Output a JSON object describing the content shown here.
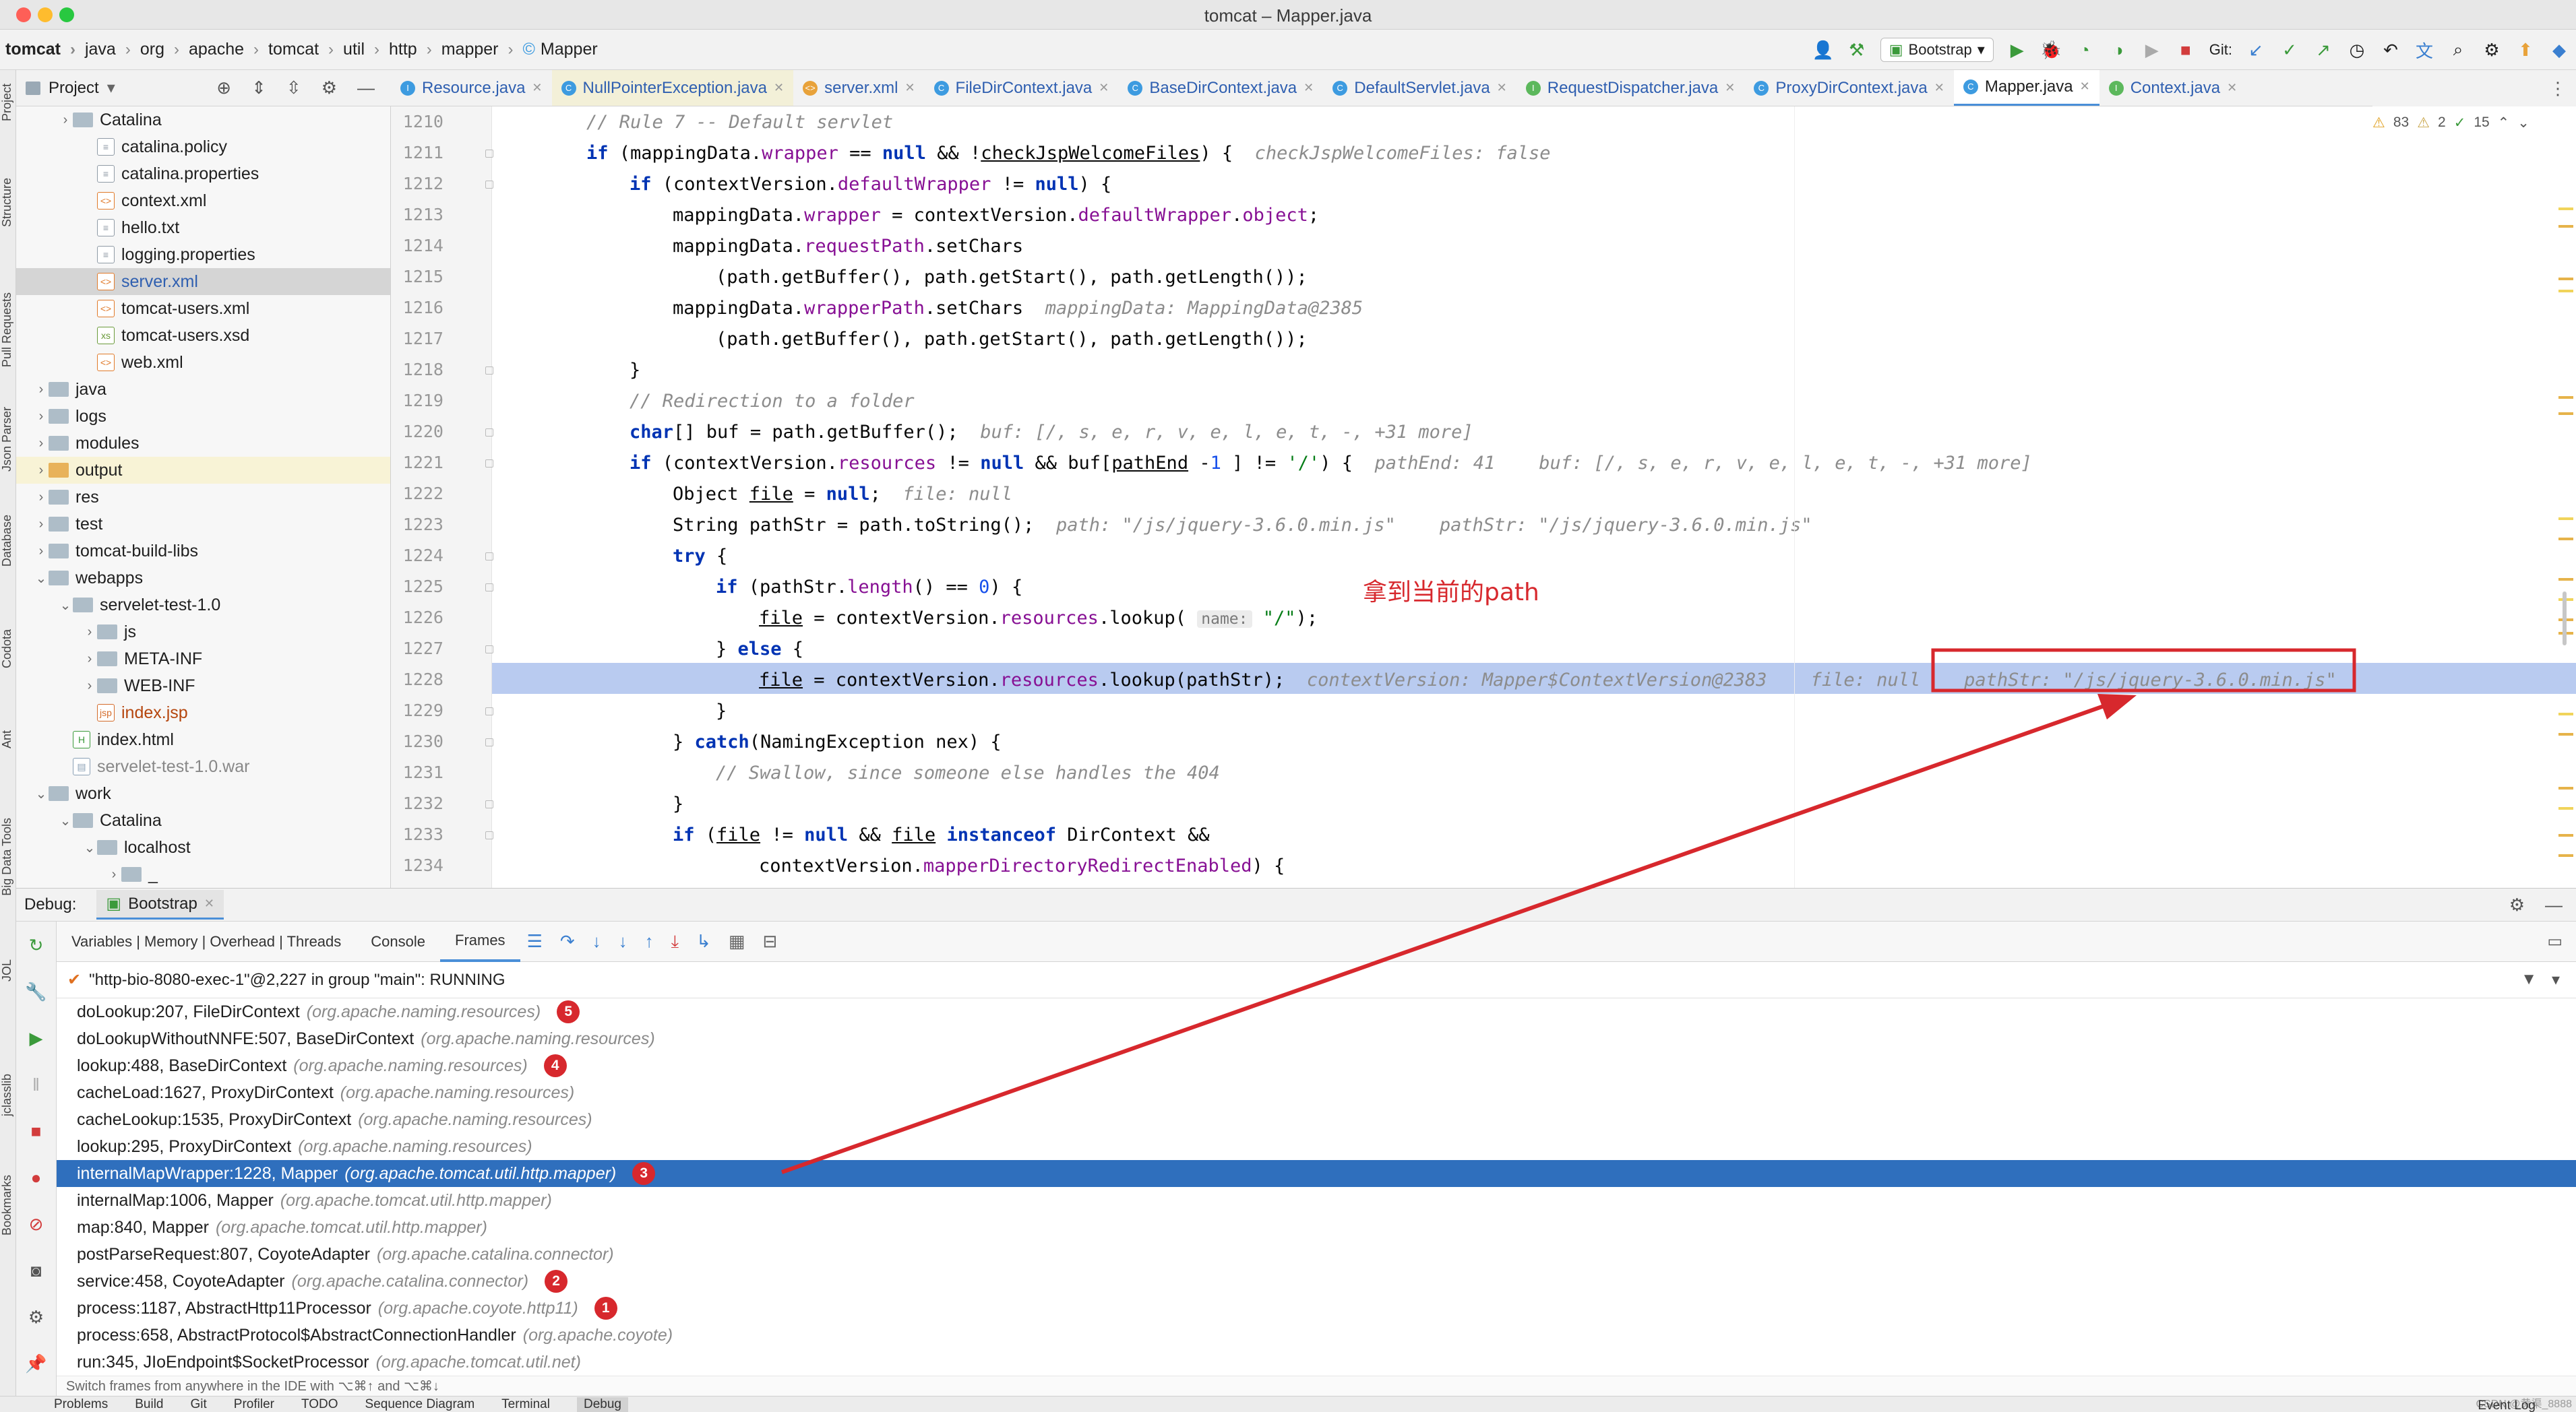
{
  "window": {
    "title": "tomcat – Mapper.java"
  },
  "breadcrumbs": [
    "tomcat",
    "java",
    "org",
    "apache",
    "tomcat",
    "util",
    "http",
    "mapper",
    "Mapper"
  ],
  "toolbar": {
    "run_config": "Bootstrap",
    "git_label": "Git:"
  },
  "project_panel": {
    "title": "Project",
    "tree": [
      {
        "label": "Catalina",
        "kind": "folder",
        "depth": 2,
        "expander": "closed"
      },
      {
        "label": "catalina.policy",
        "kind": "file",
        "depth": 3
      },
      {
        "label": "catalina.properties",
        "kind": "file",
        "depth": 3
      },
      {
        "label": "context.xml",
        "kind": "xml",
        "depth": 3
      },
      {
        "label": "hello.txt",
        "kind": "file",
        "depth": 3
      },
      {
        "label": "logging.properties",
        "kind": "file",
        "depth": 3
      },
      {
        "label": "server.xml",
        "kind": "xml",
        "depth": 3,
        "selected": true
      },
      {
        "label": "tomcat-users.xml",
        "kind": "xml",
        "depth": 3
      },
      {
        "label": "tomcat-users.xsd",
        "kind": "xsd",
        "depth": 3
      },
      {
        "label": "web.xml",
        "kind": "xml",
        "depth": 3
      },
      {
        "label": "java",
        "kind": "folder",
        "depth": 1,
        "expander": "closed"
      },
      {
        "label": "logs",
        "kind": "folder",
        "depth": 1,
        "expander": "closed"
      },
      {
        "label": "modules",
        "kind": "folder",
        "depth": 1,
        "expander": "closed"
      },
      {
        "label": "output",
        "kind": "folder-orange",
        "depth": 1,
        "expander": "closed",
        "highlight": true
      },
      {
        "label": "res",
        "kind": "folder",
        "depth": 1,
        "expander": "closed"
      },
      {
        "label": "test",
        "kind": "folder",
        "depth": 1,
        "expander": "closed"
      },
      {
        "label": "tomcat-build-libs",
        "kind": "folder",
        "depth": 1,
        "expander": "closed"
      },
      {
        "label": "webapps",
        "kind": "folder",
        "depth": 1,
        "expander": "open"
      },
      {
        "label": "servelet-test-1.0",
        "kind": "folder",
        "depth": 2,
        "expander": "open"
      },
      {
        "label": "js",
        "kind": "folder",
        "depth": 3,
        "expander": "closed"
      },
      {
        "label": "META-INF",
        "kind": "folder",
        "depth": 3,
        "expander": "closed"
      },
      {
        "label": "WEB-INF",
        "kind": "folder",
        "depth": 3,
        "expander": "closed"
      },
      {
        "label": "index.jsp",
        "kind": "jsp",
        "depth": 3
      },
      {
        "label": "index.html",
        "kind": "html",
        "depth": 2
      },
      {
        "label": "servelet-test-1.0.war",
        "kind": "war",
        "depth": 2
      },
      {
        "label": "work",
        "kind": "folder",
        "depth": 1,
        "expander": "open"
      },
      {
        "label": "Catalina",
        "kind": "folder",
        "depth": 2,
        "expander": "open"
      },
      {
        "label": "localhost",
        "kind": "folder",
        "depth": 3,
        "expander": "open"
      },
      {
        "label": "_",
        "kind": "folder",
        "depth": 4,
        "expander": "closed"
      }
    ]
  },
  "editor_tabs": [
    {
      "label": "Resource.java",
      "icon": "interface",
      "color": "#3d9be0"
    },
    {
      "label": "NullPointerException.java",
      "icon": "class",
      "color": "#3d9be0",
      "modified": true
    },
    {
      "label": "server.xml",
      "icon": "xml",
      "color": "#e8a23a"
    },
    {
      "label": "FileDirContext.java",
      "icon": "class",
      "color": "#3d9be0"
    },
    {
      "label": "BaseDirContext.java",
      "icon": "class",
      "color": "#3d9be0"
    },
    {
      "label": "DefaultServlet.java",
      "icon": "class",
      "color": "#3d9be0"
    },
    {
      "label": "RequestDispatcher.java",
      "icon": "interface",
      "color": "#5cb85c"
    },
    {
      "label": "ProxyDirContext.java",
      "icon": "class",
      "color": "#3d9be0"
    },
    {
      "label": "Mapper.java",
      "icon": "class",
      "color": "#3d9be0",
      "active": true
    },
    {
      "label": "Context.java",
      "icon": "interface",
      "color": "#5cb85c"
    }
  ],
  "inspections": {
    "warnings": "83",
    "weak": "2",
    "ok": "15"
  },
  "code": {
    "current_line": 1228,
    "lines": [
      {
        "n": "1210",
        "html": "<span class='cm'>// Rule 7 -- Default servlet</span>",
        "indent": 2
      },
      {
        "n": "1211",
        "html": "<span class='kw'>if</span> (mappingData.<span class='fld'>wrapper</span> == <span class='kw'>null</span> &amp;&amp; !<u>checkJspWelcomeFiles</u>) {  <span class='hint'>checkJspWelcomeFiles: false</span>",
        "indent": 2
      },
      {
        "n": "1212",
        "html": "<span class='kw'>if</span> (contextVersion.<span class='fld'>defaultWrapper</span> != <span class='kw'>null</span>) {",
        "indent": 3
      },
      {
        "n": "1213",
        "html": "mappingData.<span class='fld'>wrapper</span> = contextVersion.<span class='fld'>defaultWrapper</span>.<span class='fld'>object</span>;",
        "indent": 4
      },
      {
        "n": "1214",
        "html": "mappingData.<span class='fld'>requestPath</span>.setChars",
        "indent": 4
      },
      {
        "n": "1215",
        "html": "(path.getBuffer(), path.getStart(), path.getLength());",
        "indent": 5
      },
      {
        "n": "1216",
        "html": "mappingData.<span class='fld'>wrapperPath</span>.setChars  <span class='hint'>mappingData: MappingData@2385</span>",
        "indent": 4
      },
      {
        "n": "1217",
        "html": "(path.getBuffer(), path.getStart(), path.getLength());",
        "indent": 5
      },
      {
        "n": "1218",
        "html": "}",
        "indent": 3
      },
      {
        "n": "1219",
        "html": "<span class='cm'>// Redirection to a folder</span>",
        "indent": 3
      },
      {
        "n": "1220",
        "html": "<span class='kw'>char</span>[] buf = path.getBuffer();  <span class='hint'>buf: [/, s, e, r, v, e, l, e, t, -, +31 more]</span>",
        "indent": 3
      },
      {
        "n": "1221",
        "html": "<span class='kw'>if</span> (contextVersion.<span class='fld'>resources</span> != <span class='kw'>null</span> &amp;&amp; buf[<u>pathEnd</u> -<span class='num'>1</span> ] != <span class='str'>'/'</span>) {  <span class='hint'>pathEnd: 41    buf: [/, s, e, r, v, e, l, e, t, -, +31 more]</span>",
        "indent": 3
      },
      {
        "n": "1222",
        "html": "Object <u>file</u> = <span class='kw'>null</span>;  <span class='hint'>file: null</span>",
        "indent": 4
      },
      {
        "n": "1223",
        "html": "String pathStr = path.toString();  <span class='hint'>path: \"/js/jquery-3.6.0.min.js\"    pathStr: \"/js/jquery-3.6.0.min.js\"</span>",
        "indent": 4
      },
      {
        "n": "1224",
        "html": "<span class='kw'>try</span> {",
        "indent": 4
      },
      {
        "n": "1225",
        "html": "<span class='kw'>if</span> (pathStr.<span class='fld'>length</span>() == <span class='num'>0</span>) {",
        "indent": 5
      },
      {
        "n": "1226",
        "html": "<u>file</u> = contextVersion.<span class='fld'>resources</span>.lookup( <span class='hint-box'>name:</span> <span class='str'>\"/\"</span>);",
        "indent": 6
      },
      {
        "n": "1227",
        "html": "} <span class='kw'>else</span> {",
        "indent": 5
      },
      {
        "n": "1228",
        "html": "<u>file</u> = contextVersion.<span class='fld'>resources</span>.lookup(pathStr);  <span class='hint'>contextVersion: Mapper$ContextVersion@2383    file: null    pathStr: \"/js/jquery-3.6.0.min.js\"</span>",
        "indent": 6
      },
      {
        "n": "1229",
        "html": "}",
        "indent": 5
      },
      {
        "n": "1230",
        "html": "} <span class='kw'>catch</span>(NamingException nex) {",
        "indent": 4
      },
      {
        "n": "1231",
        "html": "<span class='cm'>// Swallow, since someone else handles the 404</span>",
        "indent": 5
      },
      {
        "n": "1232",
        "html": "}",
        "indent": 4
      },
      {
        "n": "1233",
        "html": "<span class='kw'>if</span> (<u>file</u> != <span class='kw'>null</span> &amp;&amp; <u>file</u> <span class='kw'>instanceof</span> DirContext &amp;&amp;",
        "indent": 4
      },
      {
        "n": "1234",
        "html": "contextVersion.<span class='fld'>mapperDirectoryRedirectEnabled</span>) {",
        "indent": 6
      }
    ]
  },
  "annotation": {
    "text": "拿到当前的path",
    "color": "#d7282d"
  },
  "debug": {
    "label": "Debug:",
    "session": "Bootstrap",
    "tabs": [
      "Variables | Memory | Overhead | Threads",
      "Console",
      "Frames"
    ],
    "active_tab": "Frames",
    "thread": "\"http-bio-8080-exec-1\"@2,227 in group \"main\": RUNNING",
    "frames": [
      {
        "method": "doLookup:207, FileDirContext",
        "pkg": "(org.apache.naming.resources)",
        "badge": "5"
      },
      {
        "method": "doLookupWithoutNNFE:507, BaseDirContext",
        "pkg": "(org.apache.naming.resources)",
        "badge": ""
      },
      {
        "method": "lookup:488, BaseDirContext",
        "pkg": "(org.apache.naming.resources)",
        "badge": "4"
      },
      {
        "method": "cacheLoad:1627, ProxyDirContext",
        "pkg": "(org.apache.naming.resources)",
        "badge": ""
      },
      {
        "method": "cacheLookup:1535, ProxyDirContext",
        "pkg": "(org.apache.naming.resources)",
        "badge": ""
      },
      {
        "method": "lookup:295, ProxyDirContext",
        "pkg": "(org.apache.naming.resources)",
        "badge": ""
      },
      {
        "method": "internalMapWrapper:1228, Mapper",
        "pkg": "(org.apache.tomcat.util.http.mapper)",
        "badge": "3",
        "selected": true
      },
      {
        "method": "internalMap:1006, Mapper",
        "pkg": "(org.apache.tomcat.util.http.mapper)",
        "badge": ""
      },
      {
        "method": "map:840, Mapper",
        "pkg": "(org.apache.tomcat.util.http.mapper)",
        "badge": ""
      },
      {
        "method": "postParseRequest:807, CoyoteAdapter",
        "pkg": "(org.apache.catalina.connector)",
        "badge": ""
      },
      {
        "method": "service:458, CoyoteAdapter",
        "pkg": "(org.apache.catalina.connector)",
        "badge": "2"
      },
      {
        "method": "process:1187, AbstractHttp11Processor",
        "pkg": "(org.apache.coyote.http11)",
        "badge": "1"
      },
      {
        "method": "process:658, AbstractProtocol$AbstractConnectionHandler",
        "pkg": "(org.apache.coyote)",
        "badge": ""
      },
      {
        "method": "run:345, JIoEndpoint$SocketProcessor",
        "pkg": "(org.apache.tomcat.util.net)",
        "badge": ""
      }
    ],
    "hint": "Switch frames from anywhere in the IDE with ⌥⌘↑ and ⌥⌘↓"
  },
  "left_stripe": [
    "Project",
    "Structure",
    "Pull Requests",
    "Json Parser",
    "Database",
    "Codota",
    "Ant",
    "Big Data Tools",
    "JOL",
    "jclasslib",
    "Bookmarks"
  ],
  "bottom_tabs": [
    "Problems",
    "Build",
    "Git",
    "Profiler",
    "TODO",
    "Sequence Diagram",
    "Terminal",
    "Debug"
  ],
  "bottom_active": "Debug",
  "event_log": "Event Log",
  "watermark": "CSDN @黄渠_8888"
}
